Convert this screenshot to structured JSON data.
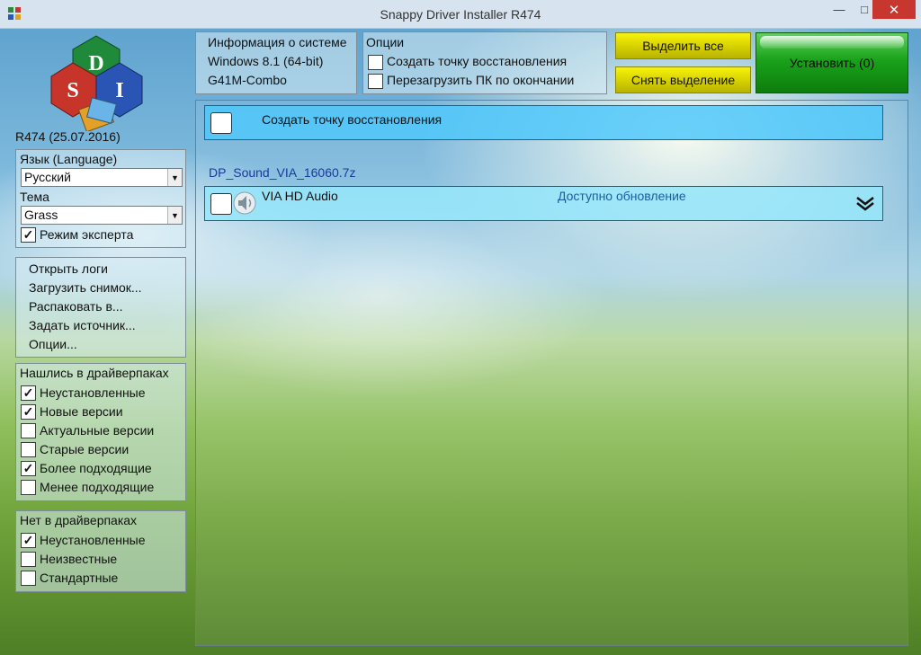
{
  "window": {
    "title": "Snappy Driver Installer R474"
  },
  "logo": {
    "version": "R474 (25.07.2016)",
    "letters": [
      "D",
      "S",
      "I"
    ]
  },
  "language": {
    "label": "Язык (Language)",
    "value": "Русский"
  },
  "theme": {
    "label": "Тема",
    "value": "Grass"
  },
  "expert_mode": {
    "label": "Режим эксперта",
    "checked": true
  },
  "actions_menu": [
    "Открыть логи",
    "Загрузить снимок...",
    "Распаковать в...",
    "Задать источник...",
    "Опции..."
  ],
  "found_in_packs": {
    "title": "Нашлись в драйверпаках",
    "items": [
      {
        "label": "Неустановленные",
        "checked": true
      },
      {
        "label": "Новые версии",
        "checked": true
      },
      {
        "label": "Актуальные версии",
        "checked": false
      },
      {
        "label": "Старые версии",
        "checked": false
      },
      {
        "label": "Более подходящие",
        "checked": true
      },
      {
        "label": "Менее подходящие",
        "checked": false
      }
    ]
  },
  "not_in_packs": {
    "title": "Нет в драйверпаках",
    "items": [
      {
        "label": "Неустановленные",
        "checked": true
      },
      {
        "label": "Неизвестные",
        "checked": false
      },
      {
        "label": "Стандартные",
        "checked": false
      }
    ]
  },
  "system_info": {
    "title": "Информация о системе",
    "os": "Windows 8.1 (64-bit)",
    "board": "G41M-Combo"
  },
  "options": {
    "title": "Опции",
    "items": [
      {
        "label": "Создать точку восстановления",
        "checked": false
      },
      {
        "label": "Перезагрузить ПК по окончании",
        "checked": false
      }
    ]
  },
  "buttons": {
    "select_all": "Выделить все",
    "deselect": "Снять выделение",
    "install": "Установить (0)"
  },
  "restore_row": {
    "label": "Создать точку восстановления"
  },
  "driverpack": {
    "name": "DP_Sound_VIA_16060.7z"
  },
  "driver_row": {
    "name": "VIA HD Audio",
    "status": "Доступно обновление"
  },
  "colors": {
    "restore_row": "#50c8fa",
    "driver_row": "#96e6fa",
    "install_button": "#1aa21a",
    "select_buttons": "#d8d300",
    "status_text": "#1a5fa0",
    "close_button": "#c7372f"
  }
}
